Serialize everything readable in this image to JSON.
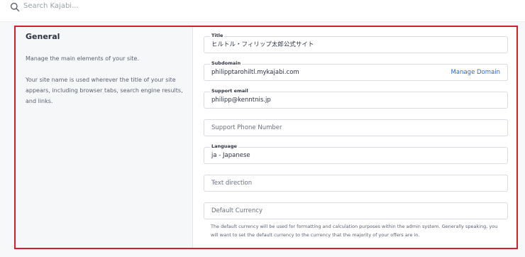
{
  "search": {
    "placeholder": "Search Kajabi..."
  },
  "section": {
    "title": "General",
    "description_1": "Manage the main elements of your site.",
    "description_2": "Your site name is used wherever the title of your site appears, including browser tabs, search engine results, and links."
  },
  "fields": {
    "title": {
      "label": "Title",
      "value": "ヒルトル・フィリップ太郎公式サイト"
    },
    "subdomain": {
      "label": "Subdomain",
      "value": "philipptarohiltl.mykajabi.com",
      "action": "Manage Domain"
    },
    "support_email": {
      "label": "Support email",
      "value": "philipp@kenntnis.jp"
    },
    "support_phone": {
      "placeholder": "Support Phone Number"
    },
    "language": {
      "label": "Language",
      "value": "ja - Japanese"
    },
    "text_direction": {
      "placeholder": "Text direction"
    },
    "default_currency": {
      "placeholder": "Default Currency",
      "helper": "The default currency will be used for formatting and calculation purposes within the admin system. Generally speaking, you will want to set the default currency to the currency that the majority of your offers are in."
    }
  },
  "colors": {
    "highlight": "#d81d2c",
    "link": "#2a6bd8"
  }
}
